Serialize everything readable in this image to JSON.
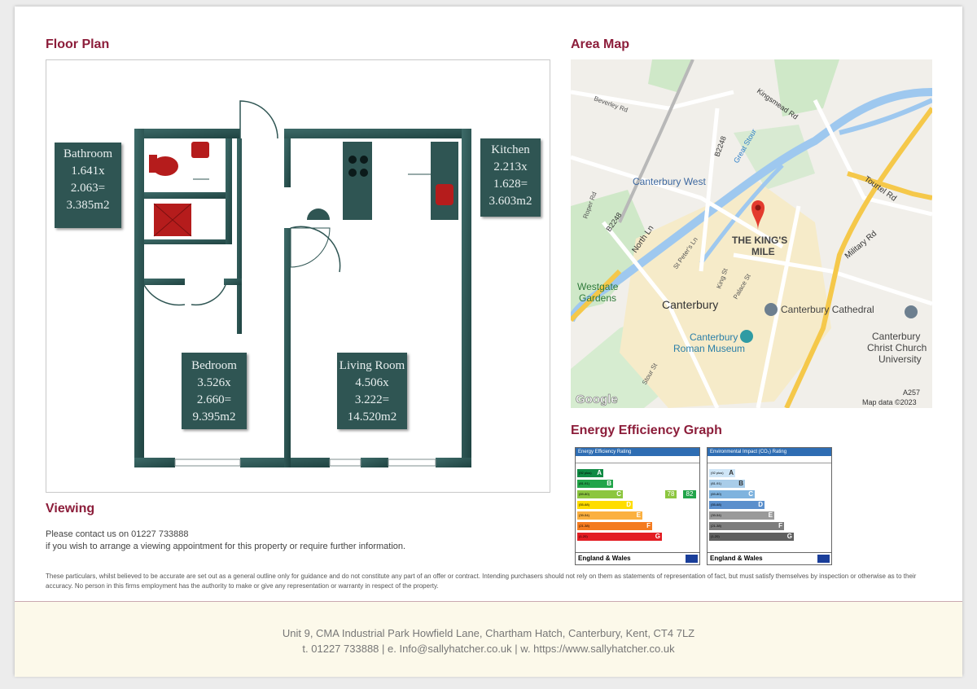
{
  "floor_plan": {
    "title": "Floor Plan",
    "rooms": [
      {
        "name": "Bathroom",
        "dim1": "1.641x",
        "dim2": "2.063=",
        "area": "3.385m2"
      },
      {
        "name": "Kitchen",
        "dim1": "2.213x",
        "dim2": "1.628=",
        "area": "3.603m2"
      },
      {
        "name": "Bedroom",
        "dim1": "3.526x",
        "dim2": "2.660=",
        "area": "9.395m2"
      },
      {
        "name": "Living Room",
        "dim1": "4.506x",
        "dim2": "3.222=",
        "area": "14.520m2"
      }
    ]
  },
  "area_map": {
    "title": "Area Map",
    "labels": {
      "beverley": "Beverley Rd",
      "kingsmead": "Kingsmead Rd",
      "b2248_top": "B2248",
      "great_stour": "Great Stour",
      "tourtel": "Tourtel Rd",
      "canterbury_west": "Canterbury West",
      "roper": "Roper Rd",
      "b2248_left": "B2248",
      "north_ln": "North Ln",
      "st_peters": "St Peter's Ln",
      "kings_mile_1": "THE KING'S",
      "kings_mile_2": "MILE",
      "military": "Military Rd",
      "westgate_1": "Westgate",
      "westgate_2": "Gardens",
      "king_st": "King St",
      "palace_st": "Palace St",
      "canterbury": "Canterbury",
      "cathedral": "Canterbury Cathedral",
      "museum_1": "Canterbury",
      "museum_2": "Roman Museum",
      "ccu_1": "Canterbury",
      "ccu_2": "Christ Church",
      "ccu_3": "University",
      "stour_st": "Stour St",
      "a257": "A257",
      "google": "Google",
      "map_data": "Map data ©2023"
    }
  },
  "energy": {
    "title": "Energy Efficiency Graph",
    "eer": {
      "title": "Energy Efficiency Rating",
      "country": "England & Wales",
      "current": "78",
      "potential": "82",
      "bands": [
        "A",
        "B",
        "C",
        "D",
        "E",
        "F",
        "G"
      ],
      "band_ranges": [
        "(92 plus)",
        "(81-91)",
        "(69-80)",
        "(55-68)",
        "(39-54)",
        "(21-38)",
        "(1-20)"
      ]
    },
    "ei": {
      "title": "Environmental Impact (CO₂) Rating",
      "country": "England & Wales",
      "bands": [
        "A",
        "B",
        "C",
        "D",
        "E",
        "F",
        "G"
      ],
      "band_ranges": [
        "(92 plus)",
        "(81-91)",
        "(69-80)",
        "(55-68)",
        "(39-54)",
        "(21-38)",
        "(1-20)"
      ]
    }
  },
  "viewing": {
    "title": "Viewing",
    "line1": "Please contact us on 01227 733888",
    "line2": "if you wish to arrange a viewing appointment for this property or require further information."
  },
  "disclaimer": "These particulars, whilst believed to be accurate are set out as a general outline only for guidance and do not constitute any part of an offer or contract. Intending purchasers should not rely on them as statements of representation of fact, but must satisfy themselves by inspection or otherwise as to their accuracy. No person in this firms employment has the authority to make or give any representation or warranty in respect of the property.",
  "footer": {
    "address": "Unit 9, CMA Industrial Park Howfield Lane, Chartham Hatch, Canterbury, Kent, CT4 7LZ",
    "contact": "t. 01227 733888  |  e. Info@sallyhatcher.co.uk  |  w. https://www.sallyhatcher.co.uk"
  },
  "colors": {
    "title": "#8c1d3a",
    "wall": "#2f5553",
    "footer_bg": "#fcf9ea"
  }
}
